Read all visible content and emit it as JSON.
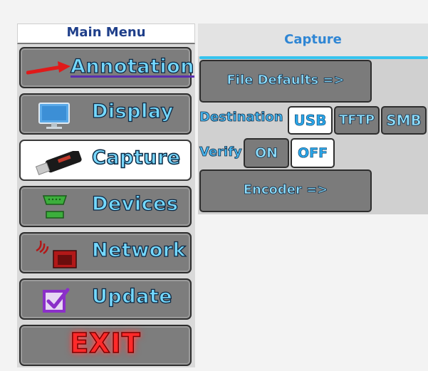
{
  "menu": {
    "title": "Main Menu",
    "items": [
      {
        "label": "Annotation",
        "icon": "red-arrow-icon"
      },
      {
        "label": "Display",
        "icon": "monitor-icon"
      },
      {
        "label": "Capture",
        "icon": "usb-stick-icon",
        "active": true
      },
      {
        "label": "Devices",
        "icon": "serial-port-icon"
      },
      {
        "label": "Network",
        "icon": "network-port-icon"
      },
      {
        "label": "Update",
        "icon": "checkbox-icon"
      },
      {
        "label": "EXIT",
        "icon": ""
      }
    ]
  },
  "panel": {
    "title": "Capture",
    "file_defaults_label": "File Defaults =>",
    "destination": {
      "label": "Destination",
      "options": [
        "USB",
        "TFTP",
        "SMB"
      ],
      "selected": "USB"
    },
    "verify": {
      "label": "Verify",
      "options": [
        "ON",
        "OFF"
      ],
      "selected": "OFF"
    },
    "encoder_label": "Encoder =>"
  },
  "colors": {
    "label_fill": "#75d9ff",
    "label_stroke": "#0f2a44",
    "accent_bar": "#35c3ee",
    "exit_red": "#ff2a2a"
  }
}
